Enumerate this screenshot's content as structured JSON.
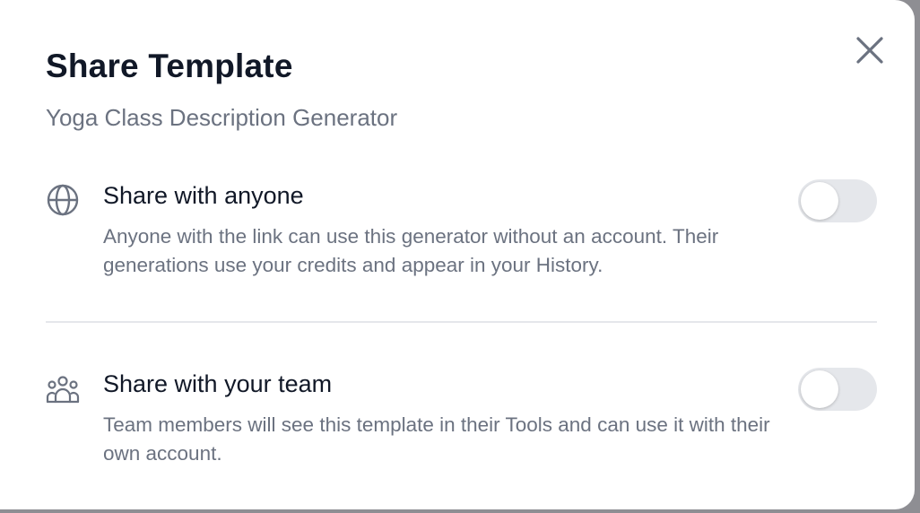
{
  "modal": {
    "title": "Share Template",
    "subtitle": "Yoga Class Description Generator",
    "close_icon": "close-icon"
  },
  "options": [
    {
      "icon": "globe-icon",
      "heading": "Share with anyone",
      "description": "Anyone with the link can use this generator without an account. Their generations use your credits and appear in your History.",
      "enabled": false
    },
    {
      "icon": "team-icon",
      "heading": "Share with your team",
      "description": "Team members will see this template in their Tools and can use it with their own account.",
      "enabled": false
    }
  ],
  "colors": {
    "title": "#111827",
    "muted_text": "#6b7280",
    "toggle_off": "#e5e7eb",
    "backdrop": "#8e8e93"
  }
}
